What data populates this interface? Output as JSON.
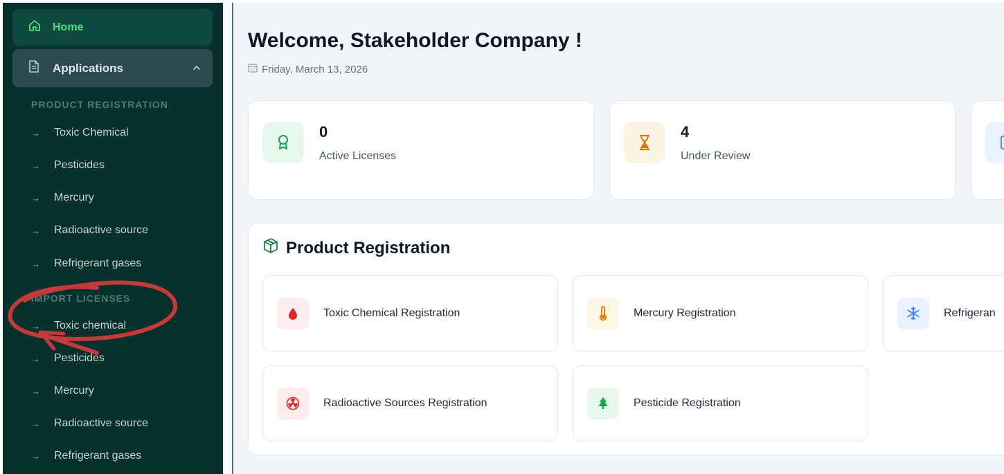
{
  "sidebar": {
    "home": {
      "label": "Home",
      "icon": "home-icon"
    },
    "applications": {
      "label": "Applications",
      "icon": "document-icon",
      "expanded": true
    },
    "product_registration": {
      "heading": "PRODUCT REGISTRATION",
      "items": [
        {
          "label": "Toxic Chemical"
        },
        {
          "label": "Pesticides"
        },
        {
          "label": "Mercury"
        },
        {
          "label": "Radioactive source"
        },
        {
          "label": "Refrigerant gases"
        }
      ]
    },
    "import_licenses": {
      "heading": "IMPORT LICENSES",
      "items": [
        {
          "label": "Toxic chemical"
        },
        {
          "label": "Pesticides"
        },
        {
          "label": "Mercury"
        },
        {
          "label": "Radioactive source"
        },
        {
          "label": "Refrigerant gases"
        }
      ]
    }
  },
  "main": {
    "welcome": "Welcome, Stakeholder Company !",
    "date": "Friday, March 13, 2026",
    "stats": [
      {
        "value": "0",
        "label": "Active Licenses",
        "icon": "award-icon",
        "color": "#16a34a",
        "bg": "#e8f7ee"
      },
      {
        "value": "4",
        "label": "Under Review",
        "icon": "hourglass-icon",
        "color": "#d97706",
        "bg": "#fdf5e1"
      }
    ],
    "product_registration": {
      "title": "Product Registration",
      "cards": [
        {
          "label": "Toxic Chemical Registration",
          "icon": "droplet-icon",
          "color": "#dc2626",
          "bg": "#fdecee"
        },
        {
          "label": "Mercury Registration",
          "icon": "thermometer-icon",
          "color": "#d97706",
          "bg": "#fdf6e3"
        },
        {
          "label": "Refrigeran",
          "icon": "snowflake-icon",
          "color": "#3b82f6",
          "bg": "#e9f2fe"
        },
        {
          "label": "Radioactive Sources Registration",
          "icon": "radiation-icon",
          "color": "#dc2626",
          "bg": "#fdecee"
        },
        {
          "label": "Pesticide Registration",
          "icon": "tree-icon",
          "color": "#16a34a",
          "bg": "#e8f7ee"
        }
      ]
    }
  },
  "colors": {
    "sidebar_bg": "#08302c",
    "home_active": "#4ade80",
    "annotation": "#c23a3a"
  }
}
